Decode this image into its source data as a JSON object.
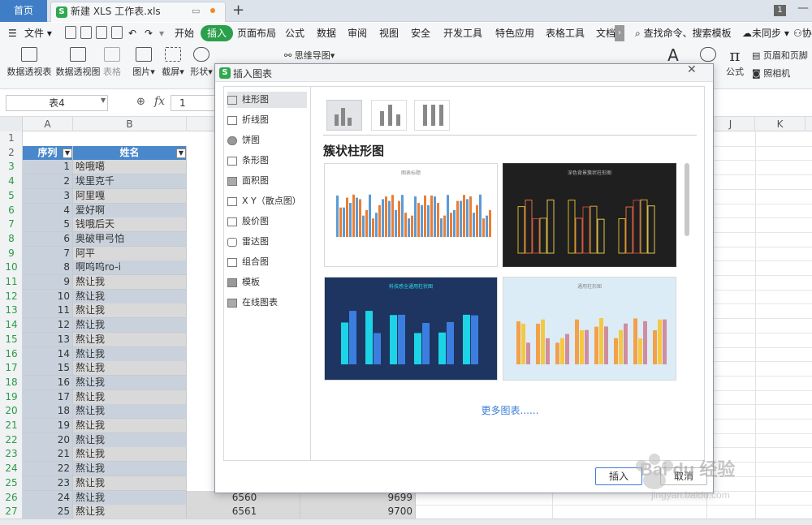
{
  "tabbar": {
    "home": "首页",
    "doc_title": "新建 XLS 工作表.xls",
    "add": "+",
    "badge": "1"
  },
  "menubar": {
    "file": "文件",
    "items": [
      "开始",
      "插入",
      "页面布局",
      "公式",
      "数据",
      "审阅",
      "视图",
      "安全",
      "开发工具",
      "特色应用",
      "表格工具",
      "文档"
    ],
    "search": "查找命令、搜索模板",
    "sync": "未同步",
    "collab": "协"
  },
  "ribbon": {
    "pivot_table": "数据透视表",
    "pivot_chart": "数据透视图",
    "table": "表格",
    "picture": "图片",
    "screenshot": "截屏",
    "shape": "形状",
    "mindmap": "思维导图",
    "header_footer": "页眉和页脚",
    "formula": "公式",
    "camera": "照相机"
  },
  "formula_bar": {
    "name_box": "表4",
    "value": "1"
  },
  "columns": {
    "A": "A",
    "B": "B",
    "J": "J",
    "K": "K"
  },
  "table": {
    "header_a": "序列",
    "header_b": "姓名",
    "rows": [
      {
        "a": "1",
        "b": "啥哦噶"
      },
      {
        "a": "2",
        "b": "埃里克千"
      },
      {
        "a": "3",
        "b": "阿里嘎"
      },
      {
        "a": "4",
        "b": "爱好啊"
      },
      {
        "a": "5",
        "b": "钱哦后天"
      },
      {
        "a": "6",
        "b": "奥破甲弓怕"
      },
      {
        "a": "7",
        "b": "阿平"
      },
      {
        "a": "8",
        "b": "啊呜呜ro-i"
      },
      {
        "a": "9",
        "b": "熬让我"
      },
      {
        "a": "10",
        "b": "熬让我"
      },
      {
        "a": "11",
        "b": "熬让我"
      },
      {
        "a": "12",
        "b": "熬让我"
      },
      {
        "a": "13",
        "b": "熬让我"
      },
      {
        "a": "14",
        "b": "熬让我"
      },
      {
        "a": "15",
        "b": "熬让我"
      },
      {
        "a": "16",
        "b": "熬让我"
      },
      {
        "a": "17",
        "b": "熬让我"
      },
      {
        "a": "18",
        "b": "熬让我"
      },
      {
        "a": "19",
        "b": "熬让我"
      },
      {
        "a": "20",
        "b": "熬让我"
      },
      {
        "a": "21",
        "b": "熬让我"
      },
      {
        "a": "22",
        "b": "熬让我"
      },
      {
        "a": "23",
        "b": "熬让我"
      },
      {
        "a": "24",
        "b": "熬让我",
        "c": "6560",
        "d": "9699"
      },
      {
        "a": "25",
        "b": "熬让我",
        "c": "6561",
        "d": "9700"
      }
    ]
  },
  "dialog": {
    "title": "插入图表",
    "chart_types": [
      "柱形图",
      "折线图",
      "饼图",
      "条形图",
      "面积图",
      "X Y（散点图）",
      "股价图",
      "雷达图",
      "组合图",
      "模板",
      "在线图表"
    ],
    "heading": "簇状柱形图",
    "thumb_titles": [
      "图表标题",
      "深色背景簇状柱形图",
      "科技感全通用柱状图",
      "通用柱形图"
    ],
    "more": "更多图表......",
    "insert_btn": "插入",
    "cancel_btn": "取消"
  },
  "watermark": {
    "brand": "Bai du 经验",
    "url": "jingyan.baidu.com"
  },
  "colors": {
    "accent_blue": "#4a87cb",
    "insert_green": "#2aa04a",
    "link_blue": "#3b7dd8"
  }
}
